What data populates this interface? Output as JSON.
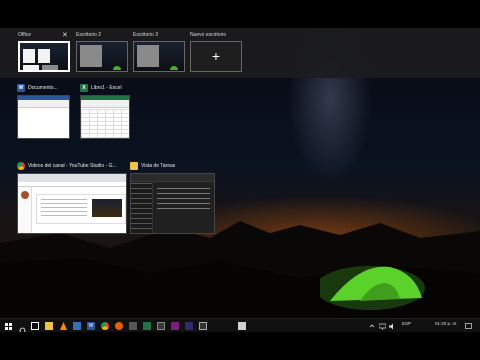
{
  "desktops": [
    {
      "label": "Office",
      "active": true
    },
    {
      "label": "Escritorio 2",
      "active": false
    },
    {
      "label": "Escritorio 3",
      "active": false
    }
  ],
  "new_desktop": {
    "label": "Nuevo escritorio",
    "icon": "plus-icon"
  },
  "windows": [
    {
      "app": "word",
      "title": "Documento...",
      "icon_letter": "W",
      "icon_color": "#2b579a"
    },
    {
      "app": "excel",
      "title": "Libro1 - Excel",
      "icon_letter": "X",
      "icon_color": "#217346"
    },
    {
      "app": "chrome",
      "title": "Videos del canal - YouTube Studio - G...",
      "icon_color": "#db4437"
    },
    {
      "app": "explorer",
      "title": "Vista de Tareas",
      "icon_color": "#f0c24b"
    }
  ],
  "taskbar": {
    "icons": [
      "start-icon",
      "search-icon",
      "task-view-icon",
      "file-explorer-icon",
      "vlc-icon",
      "app-icon",
      "word-icon",
      "chrome-icon",
      "firefox-icon",
      "app-icon",
      "app-icon",
      "app-icon",
      "app-icon",
      "app-icon",
      "app-icon"
    ],
    "language": "ESP",
    "time": "01:20 p. m."
  },
  "colors": {
    "accent": "#ffffff",
    "word": "#2b579a",
    "excel": "#217346",
    "tent": "#5bd22a"
  }
}
